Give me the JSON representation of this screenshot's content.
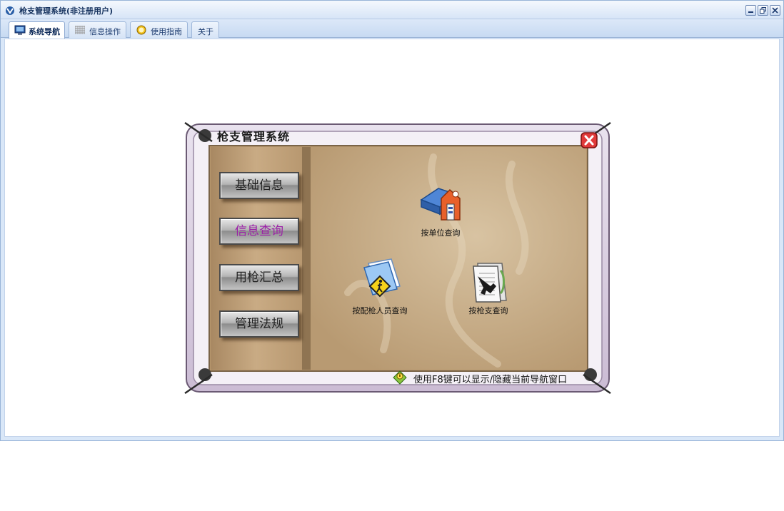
{
  "window": {
    "title": "枪支管理系统(非注册用户)"
  },
  "tabs": [
    {
      "label": "系统导航",
      "icon": "monitor-icon",
      "active": true
    },
    {
      "label": "信息操作",
      "icon": "grid-icon",
      "active": false
    },
    {
      "label": "使用指南",
      "icon": "lightbulb-icon",
      "active": false
    },
    {
      "label": "关于",
      "icon": "",
      "active": false
    }
  ],
  "nav_panel": {
    "title": "枪支管理系统",
    "menu": [
      {
        "label": "基础信息",
        "selected": false
      },
      {
        "label": "信息查询",
        "selected": true
      },
      {
        "label": "用枪汇总",
        "selected": false
      },
      {
        "label": "管理法规",
        "selected": false
      }
    ],
    "queries": [
      {
        "label": "按单位查询",
        "icon": "building-book-icon"
      },
      {
        "label": "按配枪人员查询",
        "icon": "folder-person-icon"
      },
      {
        "label": "按枪支查询",
        "icon": "gun-document-icon"
      }
    ],
    "hint": "使用F8键可以显示/隐藏当前导航窗口"
  },
  "colors": {
    "title_bar": "#d7e5f7",
    "panel_border": "#c9b9cf",
    "parchment": "#c5ad8a",
    "selected_menu_text": "#9c1fa8",
    "close_red": "#e03a3a"
  }
}
